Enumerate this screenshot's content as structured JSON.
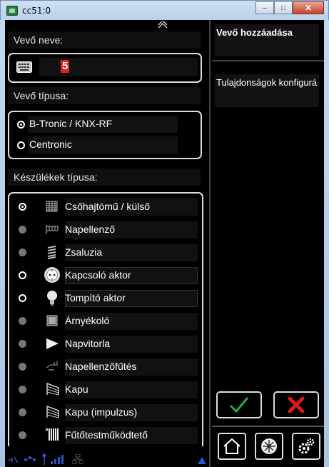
{
  "window": {
    "title": "cc51:0",
    "buttons": [
      "minimize",
      "maximize",
      "close"
    ]
  },
  "receiver_name": {
    "label": "Vevő neve:",
    "value": "5"
  },
  "receiver_type": {
    "label": "Vevő típusa:",
    "options": [
      {
        "label": "B-Tronic / KNX-RF",
        "selected": true
      },
      {
        "label": "Centronic",
        "selected": false
      }
    ]
  },
  "device_types": {
    "label": "Készülékek típusa:",
    "items": [
      {
        "label": "Csőhajtómű / külső",
        "icon": "tube-motor-icon",
        "state": "selected"
      },
      {
        "label": "Napellenző",
        "icon": "awning-icon",
        "state": "disabled"
      },
      {
        "label": "Zsaluzia",
        "icon": "blind-icon",
        "state": "disabled"
      },
      {
        "label": "Kapcsoló aktor",
        "icon": "plug-icon",
        "state": "enabled"
      },
      {
        "label": "Tompító aktor",
        "icon": "bulb-icon",
        "state": "enabled"
      },
      {
        "label": "Árnyékoló",
        "icon": "shade-icon",
        "state": "disabled"
      },
      {
        "label": "Napvitorla",
        "icon": "sail-icon",
        "state": "disabled"
      },
      {
        "label": "Napellenzőfűtés",
        "icon": "awning-heater-icon",
        "state": "disabled"
      },
      {
        "label": "Kapu",
        "icon": "gate-icon",
        "state": "disabled"
      },
      {
        "label": "Kapu (impulzus)",
        "icon": "gate-impulse-icon",
        "state": "disabled"
      },
      {
        "label": "Fűtőtestműködtető",
        "icon": "radiator-icon",
        "state": "disabled"
      }
    ]
  },
  "right_panel": {
    "title": "Vevő hozzáadása",
    "subtitle": "Tulajdonságok konfigurá"
  },
  "colors": {
    "accent_check": "#2aa84a",
    "accent_cancel": "#e01818",
    "input_value": "#e02020"
  }
}
